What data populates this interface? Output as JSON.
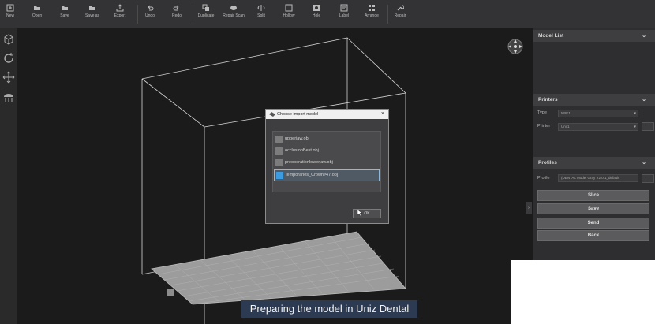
{
  "toolbar": {
    "buttons": [
      {
        "label": "New",
        "icon": "plus-square-icon"
      },
      {
        "label": "Open",
        "icon": "folder-open-icon"
      },
      {
        "label": "Save",
        "icon": "folder-icon"
      },
      {
        "label": "Save as",
        "icon": "folder-icon"
      },
      {
        "label": "Export",
        "icon": "export-icon"
      },
      {
        "label": "Undo",
        "icon": "undo-icon"
      },
      {
        "label": "Redo",
        "icon": "redo-icon"
      },
      {
        "label": "Duplicate",
        "icon": "duplicate-icon"
      },
      {
        "label": "Repair Scan",
        "icon": "repair-scan-icon"
      },
      {
        "label": "Split",
        "icon": "split-icon"
      },
      {
        "label": "Hollow",
        "icon": "hollow-icon"
      },
      {
        "label": "Hole",
        "icon": "hole-icon"
      },
      {
        "label": "Label",
        "icon": "label-icon"
      },
      {
        "label": "Arrange",
        "icon": "arrange-icon"
      },
      {
        "label": "Repair",
        "icon": "wrench-icon"
      }
    ]
  },
  "panel": {
    "model_list": {
      "title": "Model List"
    },
    "printers": {
      "title": "Printers",
      "type_label": "Type",
      "type_value": "NBE1",
      "printer_label": "Printer",
      "printer_value": "Unit1"
    },
    "profiles": {
      "title": "Profiles",
      "profile_label": "Profile",
      "profile_value": "(DENTAL Model Gray V2 0.1_default",
      "buttons": {
        "slice": "Slice",
        "save": "Save",
        "send": "Send",
        "back": "Back"
      }
    }
  },
  "dialog": {
    "title": "Choose import model",
    "files": [
      {
        "name": "upperjaw.obj",
        "selected": false
      },
      {
        "name": "occlusionBest.obj",
        "selected": false
      },
      {
        "name": "preoperationlowerjaw.obj",
        "selected": false
      },
      {
        "name": "temporaries_Crown#47.obj",
        "selected": true
      }
    ],
    "ok_label": "OK"
  },
  "caption": {
    "text": "Preparing the model in Uniz Dental"
  },
  "colors": {
    "accent": "#3d9be0",
    "caption_bg": "#2c3a52",
    "panel_bg": "#2e2e30"
  }
}
